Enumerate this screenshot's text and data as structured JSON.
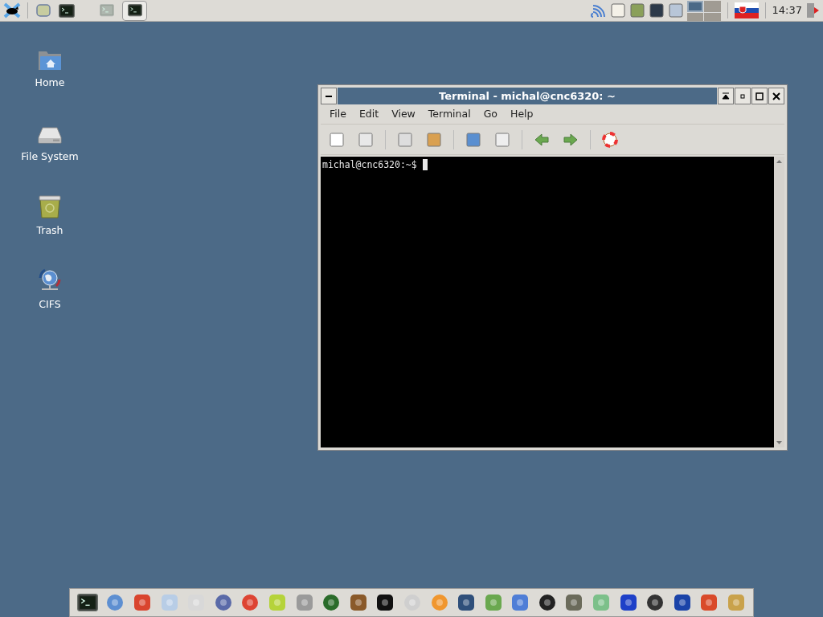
{
  "panel": {
    "tasks": [
      {
        "kind": "dim",
        "selected": false
      },
      {
        "kind": "terminal",
        "selected": true
      }
    ],
    "workspaces": [
      {
        "selected": true
      },
      {
        "selected": false
      },
      {
        "selected": false
      },
      {
        "selected": false
      }
    ],
    "clock": "14:37"
  },
  "desktop_icons": [
    {
      "kind": "home",
      "label": "Home"
    },
    {
      "kind": "drive",
      "label": "File System"
    },
    {
      "kind": "trash",
      "label": "Trash"
    },
    {
      "kind": "network",
      "label": "CIFS"
    }
  ],
  "terminal": {
    "title": "Terminal - michal@cnc6320: ~",
    "menu": [
      "File",
      "Edit",
      "View",
      "Terminal",
      "Go",
      "Help"
    ],
    "prompt": "michal@cnc6320:~$"
  }
}
